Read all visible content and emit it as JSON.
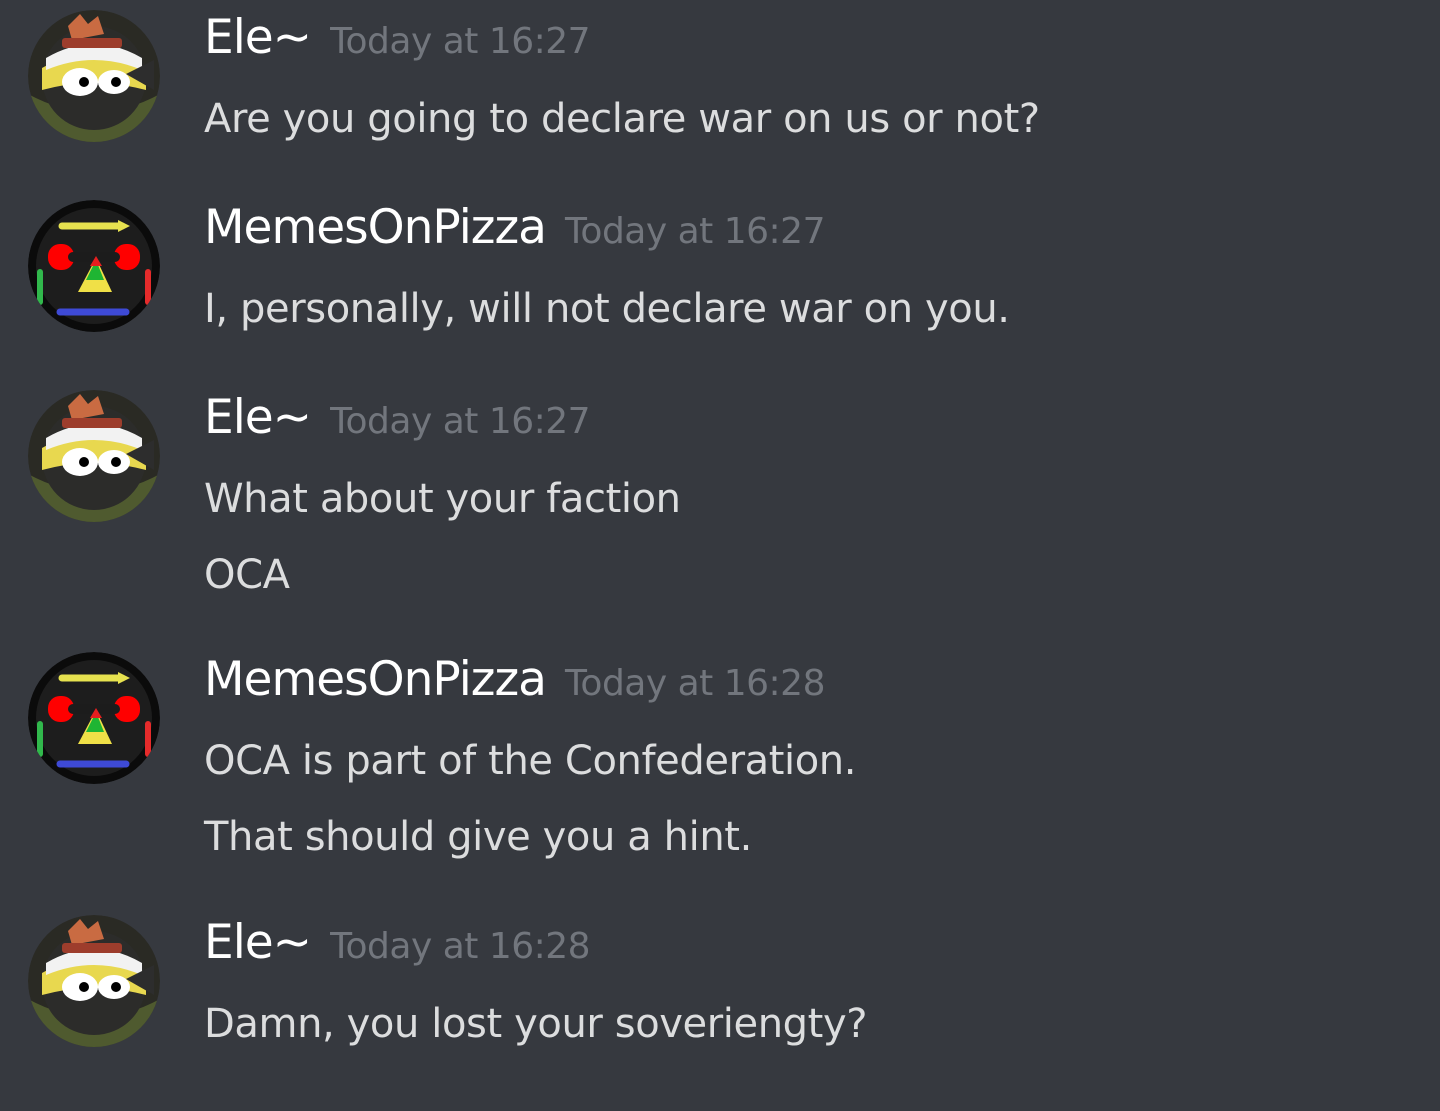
{
  "messages": [
    {
      "author": "Ele~",
      "timestamp": "Today at 16:27",
      "lines": [
        "Are you going to declare war on us or not?"
      ]
    },
    {
      "author": "MemesOnPizza",
      "timestamp": "Today at 16:27",
      "lines": [
        "I, personally, will not declare war on you."
      ]
    },
    {
      "author": "Ele~",
      "timestamp": "Today at 16:27",
      "lines": [
        "What about your faction",
        "OCA"
      ]
    },
    {
      "author": "MemesOnPizza",
      "timestamp": "Today at 16:28",
      "lines": [
        "OCA is part of the Confederation.",
        "That should give you a hint."
      ]
    },
    {
      "author": "Ele~",
      "timestamp": "Today at 16:28",
      "lines": [
        "Damn, you lost your soveriengty?"
      ]
    }
  ],
  "colors": {
    "background": "#36393f",
    "username": "#ffffff",
    "timestamp": "#72767d",
    "message_text": "#dcddde"
  },
  "avatars": {
    "ele": "ele-avatar",
    "memes": "memesonpizza-avatar"
  }
}
